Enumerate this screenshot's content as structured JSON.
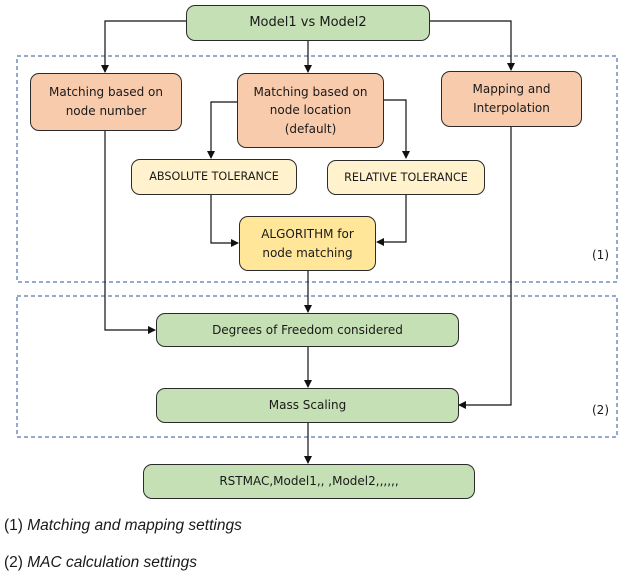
{
  "diagram": {
    "title_node": "Model1 vs Model2",
    "nodes": {
      "match_number": "Matching based on\nnode number",
      "match_location": "Matching based on\nnode location\n(default)",
      "mapping": "Mapping and\nInterpolation",
      "abs_tol": "ABSOLUTE TOLERANCE",
      "rel_tol": "RELATIVE TOLERANCE",
      "algorithm": "ALGORITHM for\nnode matching",
      "dof": "Degrees of Freedom considered",
      "mass": "Mass Scaling",
      "command": "RSTMAC,Model1,, ,Model2,,,,,,"
    },
    "groups": {
      "group1_label": "(1)",
      "group2_label": "(2)"
    },
    "colors": {
      "green": "#c5e0b4",
      "orange": "#f8cbad",
      "cream": "#fff2cc",
      "yellow": "#ffe699",
      "group_border": "#2f5597"
    }
  },
  "legend": [
    {
      "num": "(1)",
      "text": "Matching and mapping settings"
    },
    {
      "num": "(2)",
      "text": "MAC calculation settings"
    }
  ]
}
